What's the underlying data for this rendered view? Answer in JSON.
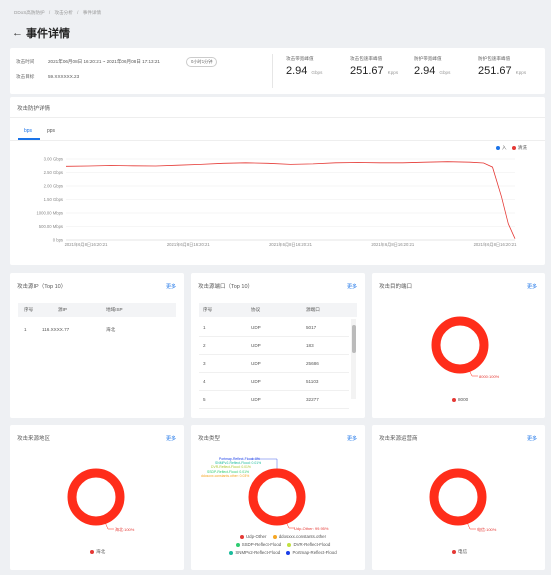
{
  "breadcrumb": [
    "DDoS高防防护",
    "攻击分析",
    "事件详情"
  ],
  "page_title": "事件详情",
  "summary": {
    "time_label": "攻击时间",
    "time_value": "2021年06月08日 16:20:21 ~ 2021年06月08日 17:13:21",
    "duration_badge": "0小时1分钟",
    "target_label": "攻击目标",
    "target_value": "59.XXXXXX.23",
    "metrics": [
      {
        "label": "攻击带宽峰值",
        "value": "2.94",
        "unit": "Gbps"
      },
      {
        "label": "攻击包速率峰值",
        "value": "251.67",
        "unit": "Kpps"
      },
      {
        "label": "防护带宽峰值",
        "value": "2.94",
        "unit": "Gbps"
      },
      {
        "label": "防护包速率峰值",
        "value": "251.67",
        "unit": "Kpps"
      }
    ]
  },
  "trend": {
    "title": "攻击防护详情",
    "tabs": [
      "bps",
      "pps"
    ],
    "legend": [
      {
        "label": "入",
        "color": "#1a73e8"
      },
      {
        "label": "清洗",
        "color": "#e53935"
      }
    ]
  },
  "chart_data": {
    "type": "line",
    "y_ticks": [
      "3.00 Gbps",
      "2.50 Gbps",
      "2.00 Gbps",
      "1.50 Gbps",
      "1000.00 Mbps",
      "500.00 Mbps",
      "0 bps"
    ],
    "x_ticks": [
      "2021年6月8日16:20:21",
      "2021年6月8日16:20:21",
      "2021年6月8日16:20:21",
      "2021年6月8日16:20:21",
      "2021年6月8日16:20:21"
    ],
    "ylim": [
      0,
      3
    ],
    "series": [
      {
        "name": "清洗",
        "color": "#e53935",
        "x": [
          0,
          0.05,
          0.1,
          0.15,
          0.2,
          0.25,
          0.3,
          0.35,
          0.4,
          0.45,
          0.5,
          0.55,
          0.6,
          0.65,
          0.7,
          0.75,
          0.8,
          0.85,
          0.9,
          0.93,
          0.95,
          0.97,
          0.985,
          1.0
        ],
        "values": [
          2.73,
          2.74,
          2.76,
          2.75,
          2.74,
          2.77,
          2.8,
          2.84,
          2.86,
          2.84,
          2.8,
          2.82,
          2.86,
          2.87,
          2.86,
          2.86,
          2.88,
          2.9,
          2.88,
          2.85,
          2.7,
          1.6,
          0.6,
          0.05
        ]
      }
    ]
  },
  "src_ip": {
    "title": "攻击源IP（Top 10）",
    "more": "更多",
    "columns": [
      "序号",
      "源IP",
      "地域ISP"
    ],
    "rows": [
      {
        "idx": "1",
        "ip": "116.XXXX.77",
        "region": "海北"
      }
    ]
  },
  "src_port": {
    "title": "攻击源端口（Top 10）",
    "more": "更多",
    "columns": [
      "序号",
      "协议",
      "源端口"
    ],
    "rows": [
      {
        "idx": "1",
        "proto": "UDP",
        "port": "5017"
      },
      {
        "idx": "2",
        "proto": "UDP",
        "port": "183"
      },
      {
        "idx": "3",
        "proto": "UDP",
        "port": "25686"
      },
      {
        "idx": "4",
        "proto": "UDP",
        "port": "51103"
      },
      {
        "idx": "5",
        "proto": "UDP",
        "port": "32277"
      }
    ]
  },
  "dst_port": {
    "title": "攻击目的端口",
    "more": "更多",
    "donut_label": "8000:100%",
    "legend": "8000"
  },
  "src_region": {
    "title": "攻击来源地区",
    "more": "更多",
    "donut_label": "海北:100%",
    "legend": "海北"
  },
  "attack_type": {
    "title": "攻击类型",
    "more": "更多",
    "stack_labels": [
      "Portmap-Reflect-Flood: 0%",
      "SNMPv2-Reflect-Flood: 0.01%",
      "DVR-Reflect-Flood: 0.01%",
      "SSDP-Reflect-Flood: 0.01%",
      "ddosoxx.constants.other: 0.03%"
    ],
    "donut_label": "Udp-Other: 99.95%",
    "legend": [
      {
        "label": "Udp-Other",
        "color": "#e53935"
      },
      {
        "label": "ddosxxx.constants.other",
        "color": "#f5a623"
      },
      {
        "label": "SSDP-Reflect-Flood",
        "color": "#2ecc71"
      },
      {
        "label": "DVR-Reflect-Flood",
        "color": "#c0e040"
      },
      {
        "label": "SNMPv2-Reflect-Flood",
        "color": "#1abc9c"
      },
      {
        "label": "Portmap-Reflect-Flood",
        "color": "#1a3ee8"
      }
    ]
  },
  "src_isp": {
    "title": "攻击来源运营商",
    "more": "更多",
    "donut_label": "电信:100%",
    "legend": "电信"
  },
  "colors": {
    "accent": "#1a73e8",
    "danger": "#e53935"
  }
}
